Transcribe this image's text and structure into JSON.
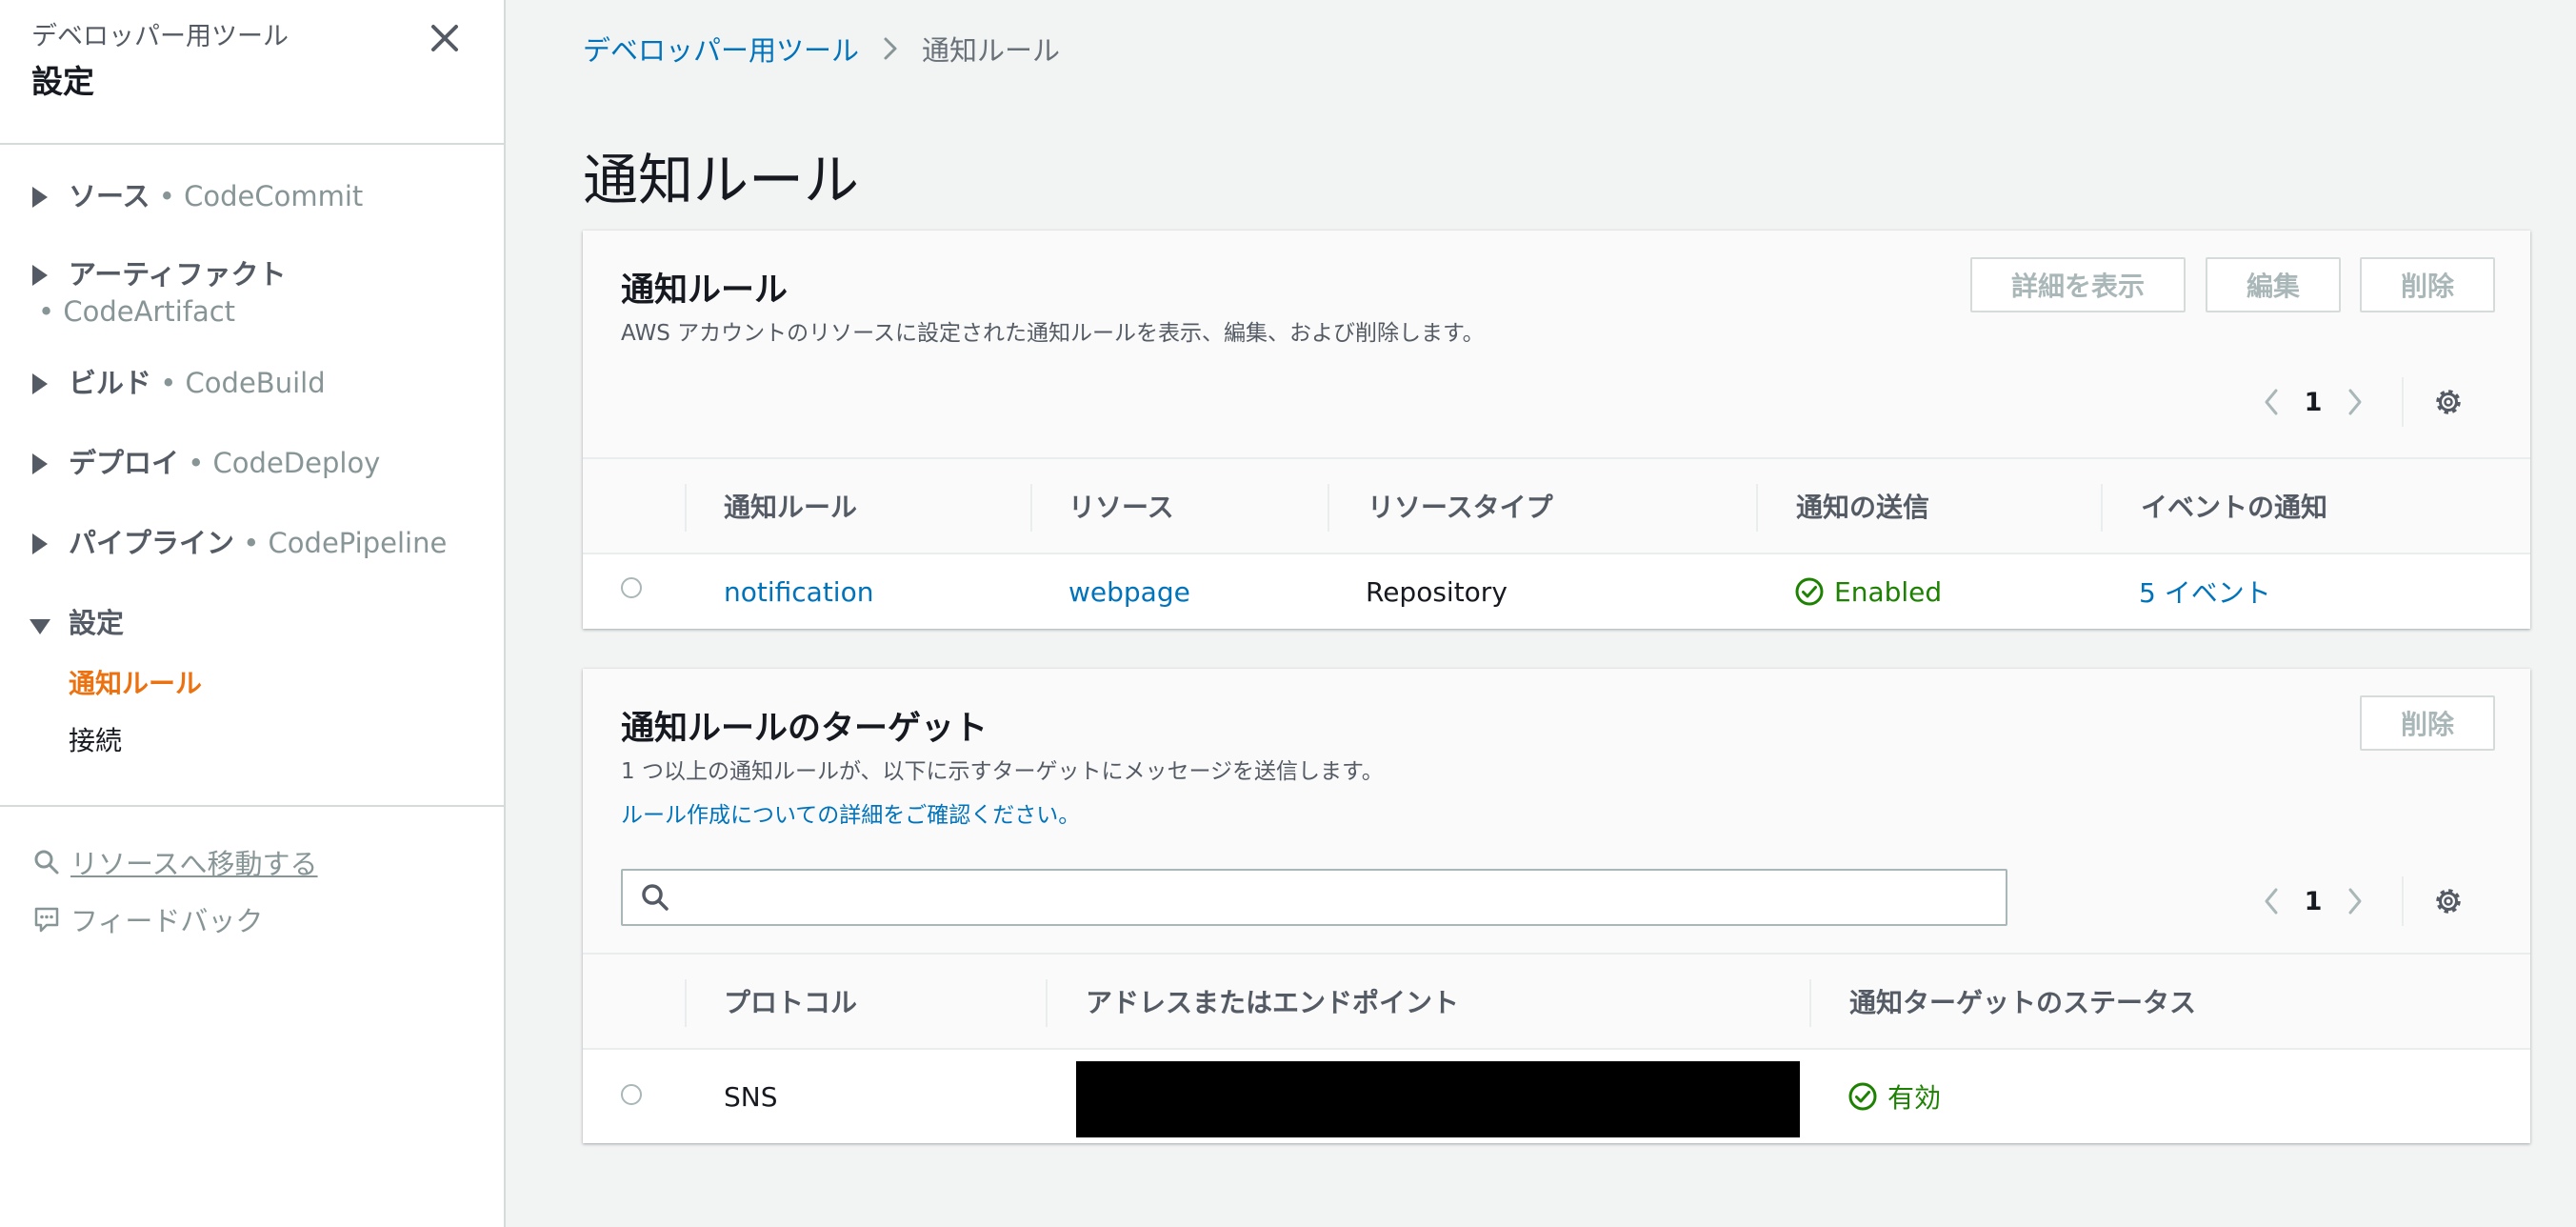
{
  "sidebar": {
    "parent": "デベロッパー用ツール",
    "title": "設定",
    "sections": [
      {
        "label": "ソース",
        "service": "• CodeCommit"
      },
      {
        "label": "アーティファクト",
        "service": "• CodeArtifact"
      },
      {
        "label": "ビルド",
        "service": "• CodeBuild"
      },
      {
        "label": "デプロイ",
        "service": "• CodeDeploy"
      },
      {
        "label": "パイプライン",
        "service": "• CodePipeline"
      },
      {
        "label": "設定",
        "service": ""
      }
    ],
    "sub_items": [
      "通知ルール",
      "接続"
    ],
    "utilities": {
      "goto_resource": "リソースへ移動する",
      "feedback": "フィードバック"
    }
  },
  "breadcrumb": {
    "parent": "デベロッパー用ツール",
    "current": "通知ルール"
  },
  "page_title": "通知ルール",
  "rules_panel": {
    "title": "通知ルール",
    "description": "AWS アカウントのリソースに設定された通知ルールを表示、編集、および削除します。",
    "buttons": {
      "details": "詳細を表示",
      "edit": "編集",
      "delete": "削除"
    },
    "page": "1",
    "columns": [
      "通知ルール",
      "リソース",
      "リソースタイプ",
      "通知の送信",
      "イベントの通知"
    ],
    "rows": [
      {
        "rule": "notification",
        "resource": "webpage",
        "resource_type": "Repository",
        "status": "Enabled",
        "events": "5 イベント"
      }
    ]
  },
  "targets_panel": {
    "title": "通知ルールのターゲット",
    "description": "1 つ以上の通知ルールが、以下に示すターゲットにメッセージを送信します。",
    "link": "ルール作成についての詳細をご確認ください。",
    "buttons": {
      "delete": "削除"
    },
    "search": {
      "value": "",
      "placeholder": ""
    },
    "page": "1",
    "columns": [
      "プロトコル",
      "アドレスまたはエンドポイント",
      "通知ターゲットのステータス"
    ],
    "rows": [
      {
        "protocol": "SNS",
        "endpoint": "",
        "status": "有効"
      }
    ]
  },
  "colors": {
    "link": "#0073bb",
    "active_nav": "#ec7211",
    "success": "#1d8102",
    "disabled": "#aab7b8",
    "background": "#f2f3f3"
  },
  "icons": [
    "close-icon",
    "chevron-right-icon",
    "chevron-left-icon",
    "gear-icon",
    "search-icon",
    "feedback-icon",
    "check-circle-icon"
  ]
}
